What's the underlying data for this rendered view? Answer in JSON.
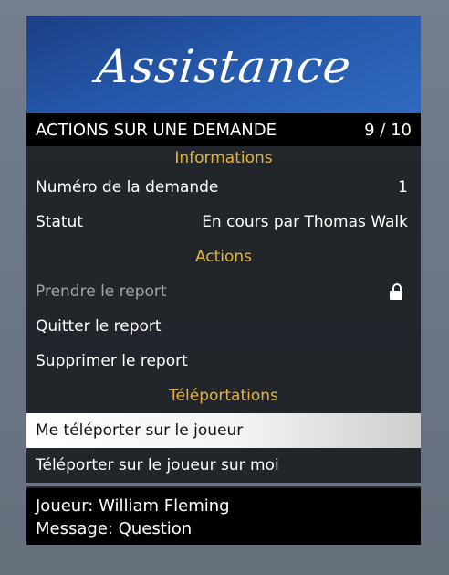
{
  "banner": {
    "title": "Assistance"
  },
  "subtitle": {
    "text": "ACTIONS SUR UNE DEMANDE",
    "counter": "9 / 10"
  },
  "sections": {
    "informations": "Informations",
    "actions": "Actions",
    "teleportations": "Téléportations"
  },
  "info": {
    "request_number_label": "Numéro de la demande",
    "request_number_value": "1",
    "status_label": "Statut",
    "status_value": "En cours par Thomas Walk"
  },
  "actions": {
    "take_report": "Prendre le report",
    "take_report_locked": true,
    "leave_report": "Quitter le report",
    "delete_report": "Supprimer le report"
  },
  "teleport": {
    "to_player": "Me téléporter sur le joueur",
    "player_to_me": "Téléporter sur le joueur sur moi"
  },
  "description": {
    "player_line": "Joueur: William Fleming",
    "message_line": "Message: Question"
  },
  "colors": {
    "banner": "#2456a8",
    "section_header": "#e6b43a",
    "selected_row": "#ffffff",
    "disabled_text": "#a3a3a3"
  }
}
